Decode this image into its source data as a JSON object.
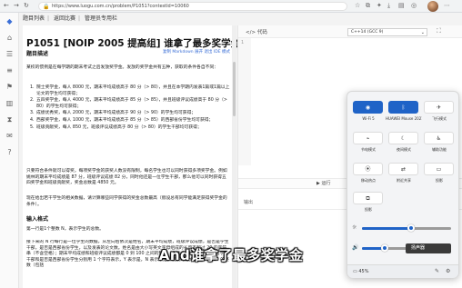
{
  "browser": {
    "url": "https://www.luogu.com.cn/problem/P1051?contestId=10060",
    "back_icon": "arrow-left-icon",
    "forward_icon": "arrow-right-icon",
    "reload_icon": "reload-icon"
  },
  "breadcrumb": [
    "题目列表",
    "返回比赛",
    "管理员专用栏"
  ],
  "problem": {
    "title": "P1051 [NOIP 2005 提高组] 谁拿了最多奖学金",
    "section_desc": "题目描述",
    "links": "复制 Markdown   展开   退出 IDE 模式",
    "intro": "某校的惯例是在每学期的期末考试之后发放奖学金。发放的奖学金共有五种，获取的条件各自不同：",
    "items": [
      "院士奖学金，每人 8000 元，期末平均成绩高于 80 分（> 80），并且在本学期内发表1篇或1篇以上论文的学生均可获得；",
      "五四奖学金，每人 4000 元，期末平均成绩高于 85 分（> 85），并且班级评议成绩高于 80 分（> 80）的学生均可获得；",
      "成绩优秀奖，每人 2000 元，期末平均成绩高于 90 分（> 90）的学生均可获得；",
      "西部奖学金，每人 1000 元，期末平均成绩高于 85 分（> 85）的西部省份学生均可获得；",
      "班级贡献奖，每人 850 元，班级评议成绩高于 80 分（> 80）的学生干部均可获得；"
    ],
    "para2": "只要符合条件就可以得奖，每项奖学金的获奖人数没有限制，每名学生也可以同时获得多项奖学金。例如姚林的期末平均成绩是 87 分，班级评议成绩 82 分，同时他还是一位学生干部，那么他可以同时获得五四奖学金和班级贡献奖，奖金总数是 4850 元。",
    "para3": "现在给出若干学生的相关数据，请计算哪些同学获得的奖金总数最高（假设总有同学能满足获得奖学金的条件）。",
    "section_input": "输入格式",
    "input_line1": "第一行是1个整数 N，表示学生的总数。",
    "input_line2": "接下来的 N 行每行是一位学生的数据，从左向右依次是姓名，期末平均成绩，班级评议成绩，是否是学生干部，是否是西部省份学生，以及发表的论文数。姓名是由大小写英文字母组成的长度不超过 20 的字符串（不含空格）；期末平均成绩和班级评议成绩都是 0 到 100 之间的整数（包括 0 和 100）；是否是学生干部和是否是西部省份学生分别用 1 个字符表示，Y 表示是，N 表示不是；发表的论文数是 0 到 10 的整数（包括"
  },
  "editor": {
    "header_label": "代码",
    "language": "C++14 (GCC 9)",
    "line_number": "1",
    "run_label": "运行",
    "submit_label": "提交",
    "output_label": "输出"
  },
  "quick_settings": {
    "tiles": [
      {
        "icon": "wifi-icon",
        "label": "Wi-Fi 5",
        "active": true
      },
      {
        "icon": "bluetooth-icon",
        "label": "HUAWEI Mouse 2021",
        "active": true
      },
      {
        "icon": "airplane-icon",
        "label": "飞行模式",
        "active": false
      },
      {
        "icon": "battery-saver-icon",
        "label": "节电模式",
        "active": false
      },
      {
        "icon": "night-light-icon",
        "label": "夜间模式",
        "active": false
      },
      {
        "icon": "accessibility-icon",
        "label": "辅助功能",
        "active": false
      },
      {
        "icon": "hotspot-icon",
        "label": "移动热点",
        "active": false
      },
      {
        "icon": "nearby-share-icon",
        "label": "附近共享",
        "active": false
      },
      {
        "icon": "cast-icon",
        "label": "投影",
        "active": false
      },
      {
        "icon": "project-icon",
        "label": "投影",
        "active": false
      }
    ],
    "brightness": 0.55,
    "volume": 0.25,
    "volume_tooltip": "扬声器",
    "battery_label": "45%",
    "battery_icon": "battery-icon",
    "edit_icon": "pencil-icon",
    "settings_icon": "gear-icon"
  },
  "subtitle": "And谁拿了最多奖学金"
}
